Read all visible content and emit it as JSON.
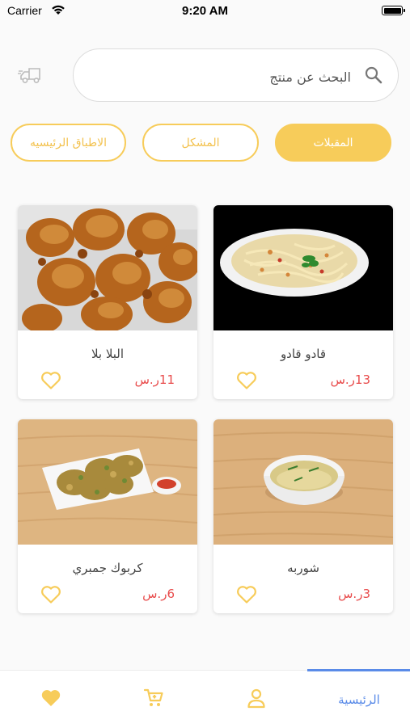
{
  "status_bar": {
    "carrier": "Carrier",
    "time": "9:20 AM"
  },
  "search": {
    "placeholder": "البحث عن منتج"
  },
  "categories": [
    {
      "label": "المقبلات",
      "active": true
    },
    {
      "label": "المشكل",
      "active": false
    },
    {
      "label": "الاطباق الرئيسيه",
      "active": false
    }
  ],
  "products": [
    {
      "name": "قادو قادو",
      "price": "13ر.س",
      "image": "plate of noodles salad"
    },
    {
      "name": "البلا بلا",
      "price": "11ر.س",
      "image": "fried fritters"
    },
    {
      "name": "شوربه",
      "price": "3ر.س",
      "image": "bowl of soup"
    },
    {
      "name": "كربوك جمبري",
      "price": "6ر.س",
      "image": "shrimp fritters with sauce"
    }
  ],
  "tabbar": {
    "home_label": "الرئيسية"
  },
  "colors": {
    "accent": "#f7cc5a",
    "price": "#e84b4b",
    "active_tab": "#5a8be8"
  }
}
